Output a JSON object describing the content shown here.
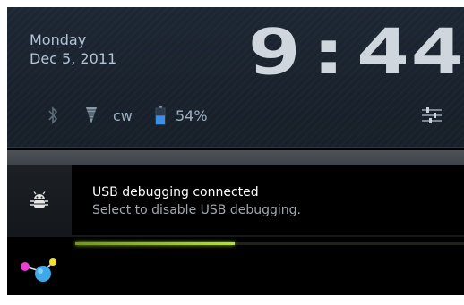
{
  "header": {
    "day": "Monday",
    "date": "Dec 5, 2011",
    "time": "9:44"
  },
  "status": {
    "carrier": "cw",
    "battery_percent": "54%",
    "battery_level": 0.54,
    "icons": [
      "bluetooth-icon",
      "signal-icon",
      "battery-icon",
      "settings-icon"
    ]
  },
  "notification": {
    "title": "USB debugging connected",
    "subtitle": "Select to disable USB debugging.",
    "icon": "android-bug-icon"
  },
  "bottom": {
    "progress": 0.41,
    "icon": "molecule-icon"
  },
  "colors": {
    "clock": "#cfd6de",
    "accent_green": "#9acd32",
    "battery_blue": "#3b8fe6"
  }
}
